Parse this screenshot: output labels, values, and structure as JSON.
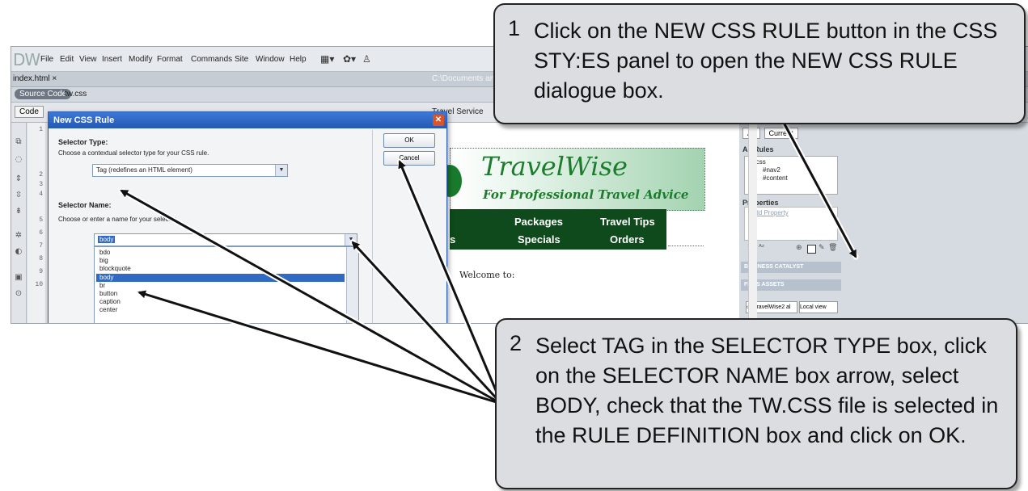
{
  "app": {
    "logo": "DW",
    "menu": [
      "File",
      "Edit",
      "View",
      "Insert",
      "Modify",
      "Format",
      "Commands",
      "Site",
      "Window",
      "Help"
    ],
    "document_tab": "index.html ×",
    "document_path": "C:\\Documents and",
    "related_source": "Source Code",
    "related_file": "tw.css",
    "view_code": "Code",
    "document_title": "Travel Service"
  },
  "line_numbers": [
    "1",
    "2",
    "3",
    "4",
    "5",
    "6",
    "7",
    "8",
    "9",
    "10"
  ],
  "design_view": {
    "brand_title": "TravelWise",
    "brand_subtitle": "For Professional Travel Advice",
    "nav": [
      "Packages",
      "Travel Tips",
      "s",
      "Specials",
      "Orders"
    ],
    "welcome": "Welcome to:"
  },
  "css_panel": {
    "tabs": [
      "All",
      "Current"
    ],
    "all_rules_label": "All Rules",
    "rules": [
      "tw.css",
      "#nav2",
      "#content"
    ],
    "properties_label": "Properties",
    "add_property": "Add Property",
    "business_catalyst": "BUSINESS CATALYST",
    "files_tabs": "FILES  ASSETS",
    "site_select": "TravelWise2 al",
    "view_select": "Local view"
  },
  "dialog": {
    "title": "New CSS Rule",
    "selector_type_label": "Selector Type:",
    "selector_type_help": "Choose a contextual selector type for your CSS rule.",
    "selector_type_value": "Tag (redefines an HTML element)",
    "selector_name_label": "Selector Name:",
    "selector_name_help": "Choose or enter a name for your selector.",
    "selector_name_value": "body",
    "options": [
      "bdo",
      "big",
      "blockquote",
      "body",
      "br",
      "button",
      "caption",
      "center"
    ],
    "selected_option": "body",
    "ok_label": "OK",
    "cancel_label": "Cancel"
  },
  "callouts": {
    "step1_num": "1",
    "step1_text": "Click on the NEW CSS RULE button in the CSS STY:ES panel to open the NEW CSS RULE dialogue box.",
    "step2_num": "2",
    "step2_text": "Select TAG in the SELECTOR TYPE box, click on the SELECTOR NAME box arrow, select BODY, check that the TW.CSS file is selected in the RULE DEFINITION box and click on OK."
  }
}
